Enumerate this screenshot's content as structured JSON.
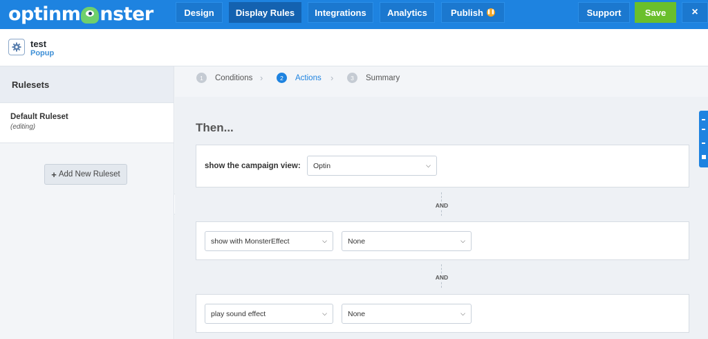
{
  "app": {
    "logo_pre": "optinm",
    "logo_post": "nster"
  },
  "nav": {
    "design": "Design",
    "display_rules": "Display Rules",
    "integrations": "Integrations",
    "analytics": "Analytics",
    "publish": "Publish",
    "support": "Support",
    "save": "Save",
    "close": "×"
  },
  "campaign": {
    "name": "test",
    "type": "Popup"
  },
  "sidebar": {
    "title": "Rulesets",
    "ruleset_name": "Default Ruleset",
    "ruleset_state": "(editing)",
    "add_button": "Add New Ruleset"
  },
  "steps": [
    {
      "num": "1",
      "label": "Conditions"
    },
    {
      "num": "2",
      "label": "Actions"
    },
    {
      "num": "3",
      "label": "Summary"
    }
  ],
  "main": {
    "heading": "Then...",
    "campaign_view_label": "show the campaign view:",
    "campaign_view_value": "Optin",
    "and_1": "AND",
    "effect_value": "show with MonsterEffect",
    "effect_option": "None",
    "and_2": "AND",
    "sound_value": "play sound effect",
    "sound_option": "None"
  },
  "colors": {
    "brand_blue": "#1e83e0",
    "save_green": "#6abf2b",
    "badge_orange": "#f5a623"
  }
}
